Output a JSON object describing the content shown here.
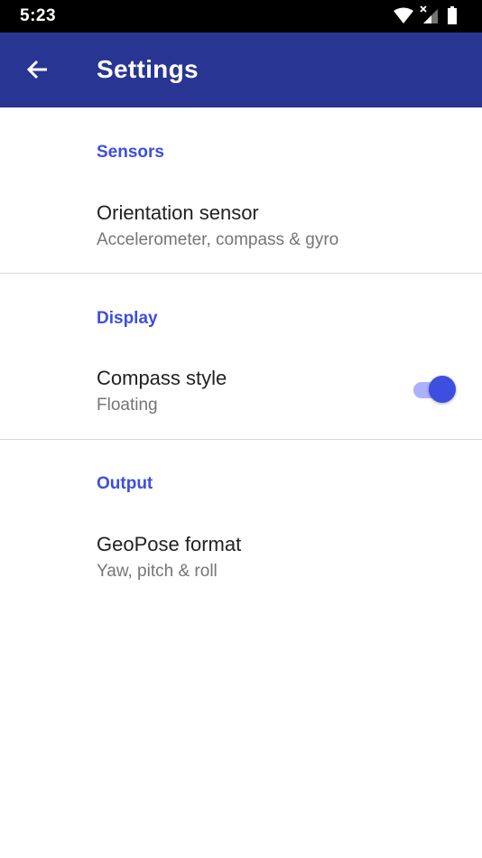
{
  "status_bar": {
    "time": "5:23",
    "icons": [
      "wifi-icon",
      "cellular-no-signal-icon",
      "battery-icon"
    ]
  },
  "app_bar": {
    "title": "Settings",
    "back_icon": "arrow-back-icon",
    "color": "#283593"
  },
  "accent_color": "#3d4ee0",
  "sections": {
    "sensors": {
      "header": "Sensors",
      "item": {
        "title": "Orientation sensor",
        "summary": "Accelerometer, compass & gyro"
      }
    },
    "display": {
      "header": "Display",
      "item": {
        "title": "Compass style",
        "summary": "Floating",
        "switch_on": true
      }
    },
    "output": {
      "header": "Output",
      "item": {
        "title": "GeoPose format",
        "summary": "Yaw, pitch & roll"
      }
    }
  }
}
